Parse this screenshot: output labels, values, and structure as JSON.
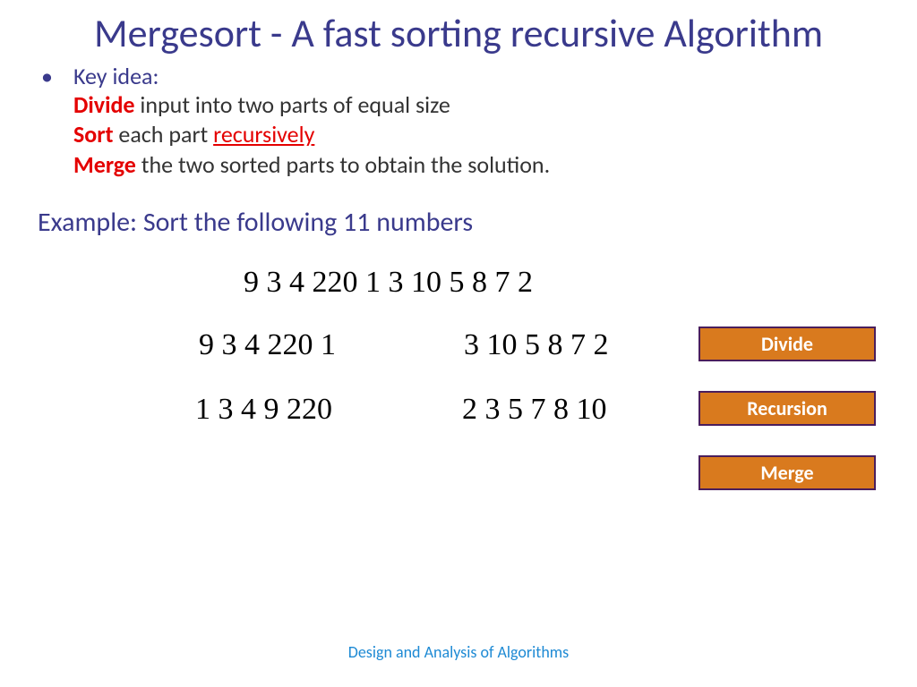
{
  "title": "Mergesort - A fast sorting recursive Algorithm",
  "bullet_label": "Key idea:",
  "lines": {
    "l1": {
      "kw": "Divide",
      "rest": " input into two parts of equal size"
    },
    "l2": {
      "kw": "Sort",
      "mid": " each part ",
      "recur": "recursively"
    },
    "l3": {
      "kw": "Merge",
      "rest": " the two sorted parts to obtain the solution."
    }
  },
  "example": "Example: Sort the following 11 numbers",
  "numbers": {
    "row_full": "9 3 4 220 1 3 10 5 8 7 2",
    "row_div_left": "9 3 4 220 1",
    "row_div_right": "3 10 5 8 7 2",
    "row_rec_left": "1 3 4 9 220",
    "row_rec_right": "2 3 5 7 8 10"
  },
  "steps": {
    "divide": "Divide",
    "recursion": "Recursion",
    "merge": "Merge"
  },
  "footer": "Design and Analysis of Algorithms"
}
